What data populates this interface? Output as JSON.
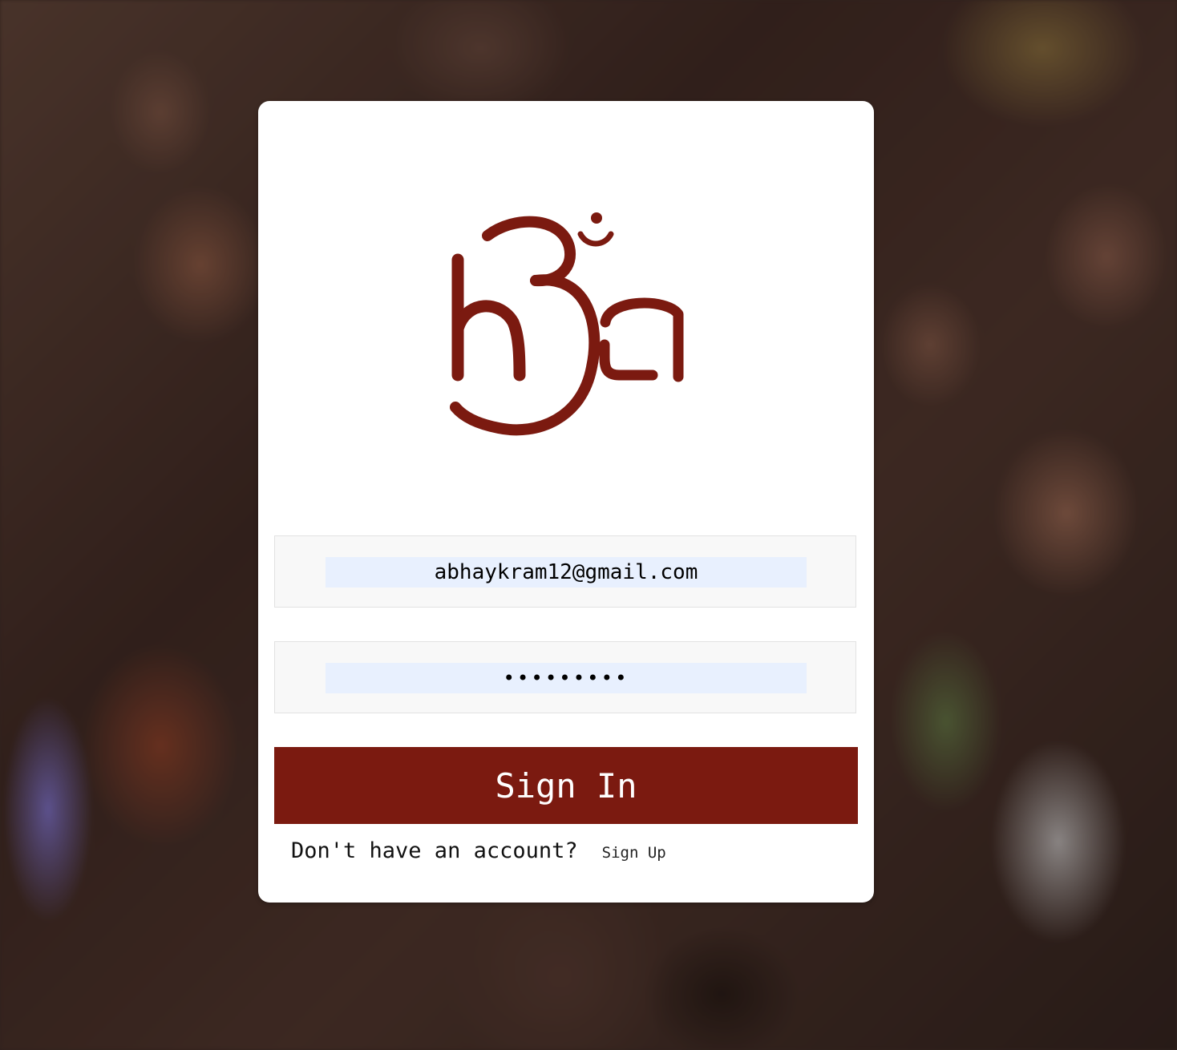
{
  "app": {
    "logo_name": "hsa-om-logo",
    "brand_color": "#7b1a10",
    "background_description_icon": "crowd-photo-background"
  },
  "login": {
    "email": {
      "value": "abhaykram12@gmail.com",
      "autofill_color": "#e8f0fe"
    },
    "password": {
      "masked_value": "•••••••••"
    },
    "submit_label": "Sign In",
    "footer_prompt": "Don't have an account?",
    "signup_label": "Sign Up"
  }
}
